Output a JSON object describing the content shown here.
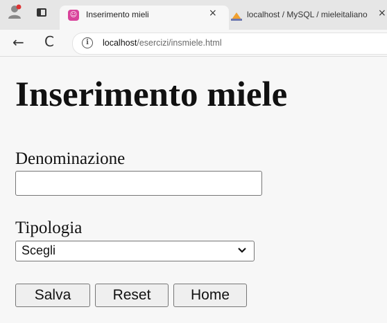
{
  "browser": {
    "tabs": [
      {
        "title": "Inserimento mieli",
        "close": "×",
        "active": true
      },
      {
        "title": "localhost / MySQL / mieleitaliano",
        "close": "×",
        "active": false
      }
    ],
    "nav": {
      "back": "←",
      "reload": "C"
    },
    "address": {
      "host": "localhost",
      "path": "/esercizi/insmiele.html"
    },
    "info_icon": "i"
  },
  "page": {
    "title": "Inserimento miele",
    "form": {
      "denominazione_label": "Denominazione",
      "denominazione_value": "",
      "tipologia_label": "Tipologia",
      "tipologia_selected": "Scegli"
    },
    "buttons": {
      "save": "Salva",
      "reset": "Reset",
      "home": "Home"
    }
  },
  "colors": {
    "tab_favicon": "#d9439b",
    "tabstrip_bg": "#e6e6e6",
    "page_bg": "#f7f7f7"
  }
}
